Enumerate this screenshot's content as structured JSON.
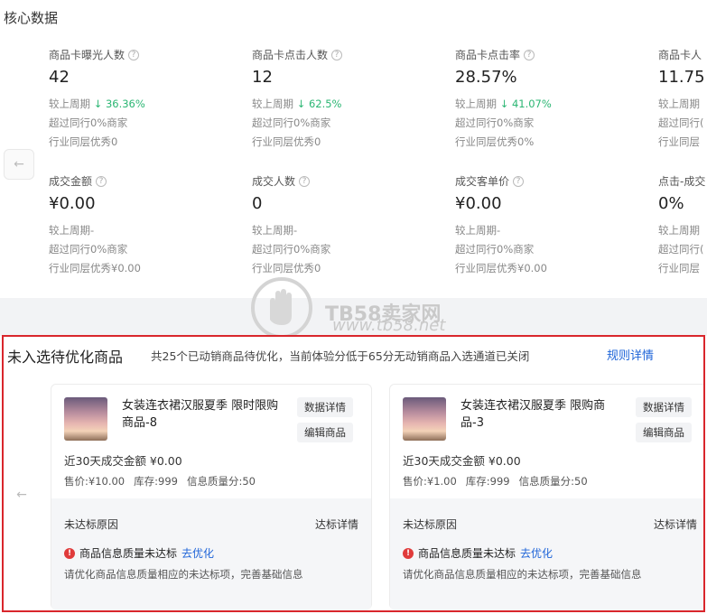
{
  "core": {
    "title": "核心数据",
    "metrics_row1": [
      {
        "label": "商品卡曝光人数",
        "value": "42",
        "compare": "较上周期",
        "trend": "↓ 36.36%",
        "peer": "超过同行0%商家",
        "industry": "行业同层优秀0"
      },
      {
        "label": "商品卡点击人数",
        "value": "12",
        "compare": "较上周期",
        "trend": "↓ 62.5%",
        "peer": "超过同行0%商家",
        "industry": "行业同层优秀0"
      },
      {
        "label": "商品卡点击率",
        "value": "28.57%",
        "compare": "较上周期",
        "trend": "↓ 41.07%",
        "peer": "超过同行0%商家",
        "industry": "行业同层优秀0%"
      },
      {
        "label": "商品卡人",
        "value": "11.75",
        "compare": "较上周期",
        "trend": "",
        "peer": "超过同行(",
        "industry": "行业同层"
      }
    ],
    "metrics_row2": [
      {
        "label": "成交金额",
        "value": "¥0.00",
        "compare": "较上周期-",
        "peer": "超过同行0%商家",
        "industry": "行业同层优秀¥0.00"
      },
      {
        "label": "成交人数",
        "value": "0",
        "compare": "较上周期-",
        "peer": "超过同行0%商家",
        "industry": "行业同层优秀0"
      },
      {
        "label": "成交客单价",
        "value": "¥0.00",
        "compare": "较上周期-",
        "peer": "超过同行0%商家",
        "industry": "行业同层优秀¥0.00"
      },
      {
        "label": "点击-成交",
        "value": "0%",
        "compare": "较上周期",
        "peer": "超过同行(",
        "industry": "行业同层"
      }
    ],
    "prev_arrow": "←"
  },
  "watermark": {
    "brand": "TB58卖家网",
    "url": "www.tb58.net"
  },
  "optimize": {
    "title": "未入选待优化商品",
    "desc": "共25个已动销商品待优化，当前体验分低于65分无动销商品入选通道已关闭",
    "link": "规则详情",
    "prev_arrow": "←",
    "products": [
      {
        "title": "女装连衣裙汉服夏季 限时限购商品-8",
        "btn_data": "数据详情",
        "btn_edit": "编辑商品",
        "sales": "近30天成交金额 ¥0.00",
        "price": "售价:¥10.00",
        "stock": "库存:999",
        "quality": "信息质量分:50",
        "reason_title": "未达标原因",
        "reason_link": "达标详情",
        "warn": "商品信息质量未达标",
        "warn_action": "去优化",
        "reason_desc": "请优化商品信息质量相应的未达标项，完善基础信息"
      },
      {
        "title": "女装连衣裙汉服夏季 限购商品-3",
        "btn_data": "数据详情",
        "btn_edit": "编辑商品",
        "sales": "近30天成交金额 ¥0.00",
        "price": "售价:¥1.00",
        "stock": "库存:999",
        "quality": "信息质量分:50",
        "reason_title": "未达标原因",
        "reason_link": "达标详情",
        "warn": "商品信息质量未达标",
        "warn_action": "去优化",
        "reason_desc": "请优化商品信息质量相应的未达标项，完善基础信息"
      }
    ]
  }
}
